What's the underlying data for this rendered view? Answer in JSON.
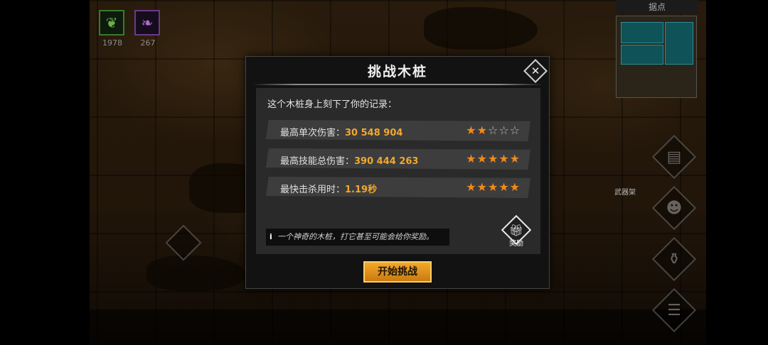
{
  "hud": {
    "skills": [
      {
        "name": "leaf-skill-icon",
        "count": "1978",
        "color": "#3a7a2a"
      },
      {
        "name": "feather-skill-icon",
        "count": "267",
        "color": "#6a3a8a"
      }
    ],
    "minimap_title": "据点",
    "weapon_rack_label": "武器架"
  },
  "modal": {
    "title": "挑战木桩",
    "intro": "这个木桩身上刻下了你的记录：",
    "records": [
      {
        "label": "最高单次伤害：",
        "value": "30 548 904",
        "stars": 2
      },
      {
        "label": "最高技能总伤害：",
        "value": "390 444 263",
        "stars": 5
      },
      {
        "label": "最快击杀用时：",
        "value": "1.19秒",
        "stars": 5
      }
    ],
    "tip": "一个神奇的木桩，打它甚至可能会给你奖励。",
    "reward_label": "奖励",
    "start_button": "开始挑战"
  },
  "colors": {
    "accent": "#f0a830",
    "star": "#f08a1c"
  }
}
